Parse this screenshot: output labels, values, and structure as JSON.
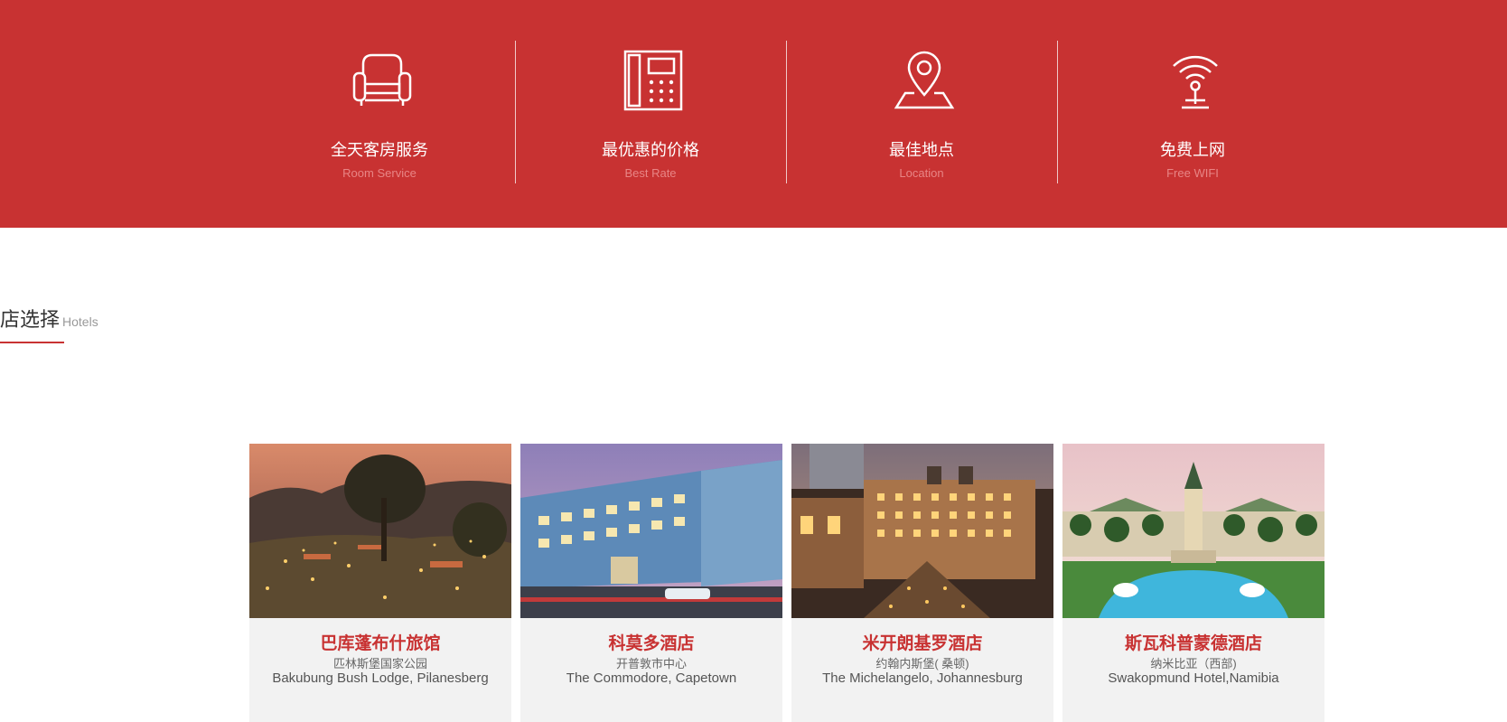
{
  "features": [
    {
      "icon": "armchair-icon",
      "title_cn": "全天客房服务",
      "title_en": "Room Service"
    },
    {
      "icon": "phone-icon",
      "title_cn": "最优惠的价格",
      "title_en": "Best Rate"
    },
    {
      "icon": "location-pin-icon",
      "title_cn": "最佳地点",
      "title_en": "Location"
    },
    {
      "icon": "wifi-icon",
      "title_cn": "免费上网",
      "title_en": "Free WIFI"
    }
  ],
  "hotels_section": {
    "title_cn": "店选择",
    "title_en": "Hotels"
  },
  "hotels": [
    {
      "name": "巴库蓬布什旅馆",
      "location": "匹林斯堡国家公园",
      "name_en": "Bakubung Bush Lodge, Pilanesberg"
    },
    {
      "name": "科莫多酒店",
      "location": "开普敦市中心",
      "name_en": "The Commodore, Capetown"
    },
    {
      "name": "米开朗基罗酒店",
      "location": "约翰内斯堡( 桑顿)",
      "name_en": "The Michelangelo, Johannesburg"
    },
    {
      "name": "斯瓦科普蒙德酒店",
      "location": "纳米比亚（西部)",
      "name_en": "Swakopmund Hotel,Namibia"
    }
  ],
  "colors": {
    "brand_red": "#c83232",
    "card_bg": "#f2f2f2"
  }
}
